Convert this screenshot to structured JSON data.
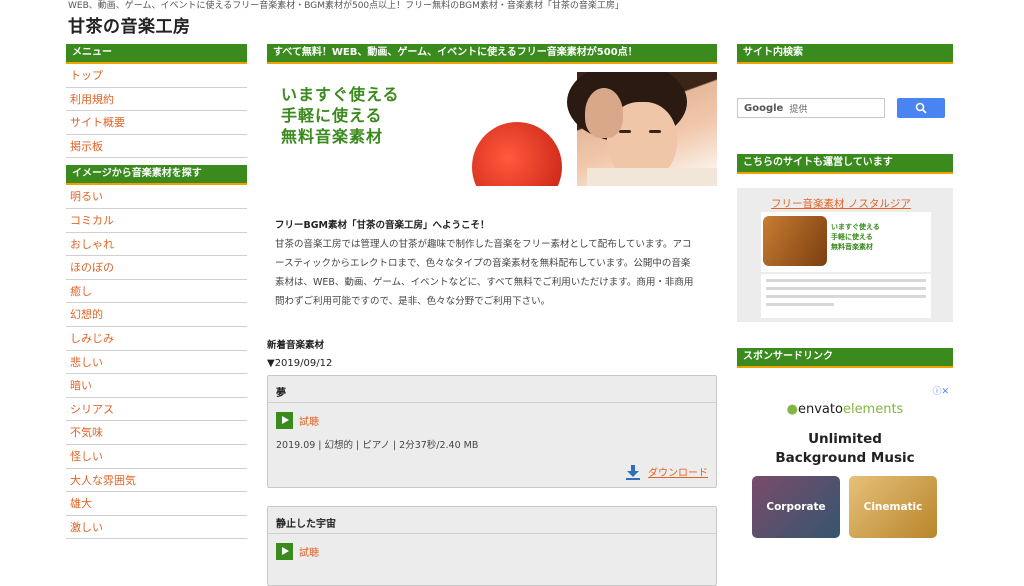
{
  "header": {
    "tagline": "WEB、動画、ゲーム、イベントに使えるフリー音楽素材・BGM素材が500点以上！フリー無料のBGM素材・音楽素材「甘茶の音楽工房」",
    "site_title": "甘茶の音楽工房"
  },
  "left": {
    "menu_heading": "メニュー",
    "menu_items": [
      "トップ",
      "利用規約",
      "サイト概要",
      "掲示板"
    ],
    "image_heading": "イメージから音楽素材を探す",
    "image_items": [
      "明るい",
      "コミカル",
      "おしゃれ",
      "ほのぼの",
      "癒し",
      "幻想的",
      "しみじみ",
      "悲しい",
      "暗い",
      "シリアス",
      "不気味",
      "怪しい",
      "大人な雰囲気",
      "雄大",
      "激しい"
    ]
  },
  "center": {
    "banner": "すべて無料！WEB、動画、ゲーム、イベントに使えるフリー音楽素材が500点！",
    "hero_lines": [
      "いますぐ使える",
      "手軽に使える",
      "無料音楽素材"
    ],
    "intro_title": "フリーBGM素材「甘茶の音楽工房」へようこそ！",
    "intro_body": "甘茶の音楽工房では管理人の甘茶が趣味で制作した音楽をフリー素材として配布しています。アコースティックからエレクトロまで、色々なタイプの音楽素材を無料配布しています。公開中の音楽素材は、WEB、動画、ゲーム、イベントなどに、すべて無料でご利用いただけます。商用・非商用問わずご利用可能ですので、是非、色々な分野でご利用下さい。",
    "new_title": "新着音楽素材",
    "date_line": "▼2019/09/12",
    "tracks": [
      {
        "title": "夢",
        "trial": "試聴",
        "meta": "2019.09 | 幻想的 | ピアノ | 2分37秒/2.40 MB",
        "download": "ダウンロード"
      },
      {
        "title": "静止した宇宙",
        "trial": "試聴"
      }
    ]
  },
  "right": {
    "search_heading": "サイト内検索",
    "search_brand": "Google",
    "search_placeholder": "提供",
    "sister_heading": "こちらのサイトも運営しています",
    "sister_link": "フリー音楽素材 ノスタルジア",
    "sister_img_lines": [
      "いますぐ使える",
      "手軽に使える",
      "無料音楽素材"
    ],
    "sponsor_heading": "スポンサードリンク",
    "ad": {
      "brand_a": "envato",
      "brand_b": "elements",
      "headline_1": "Unlimited",
      "headline_2": "Background Music",
      "tile_1": "Corporate",
      "tile_2": "Cinematic"
    }
  },
  "colors": {
    "green": "#3a8a1d",
    "link_orange": "#e06428",
    "google_blue": "#4a84f0"
  }
}
